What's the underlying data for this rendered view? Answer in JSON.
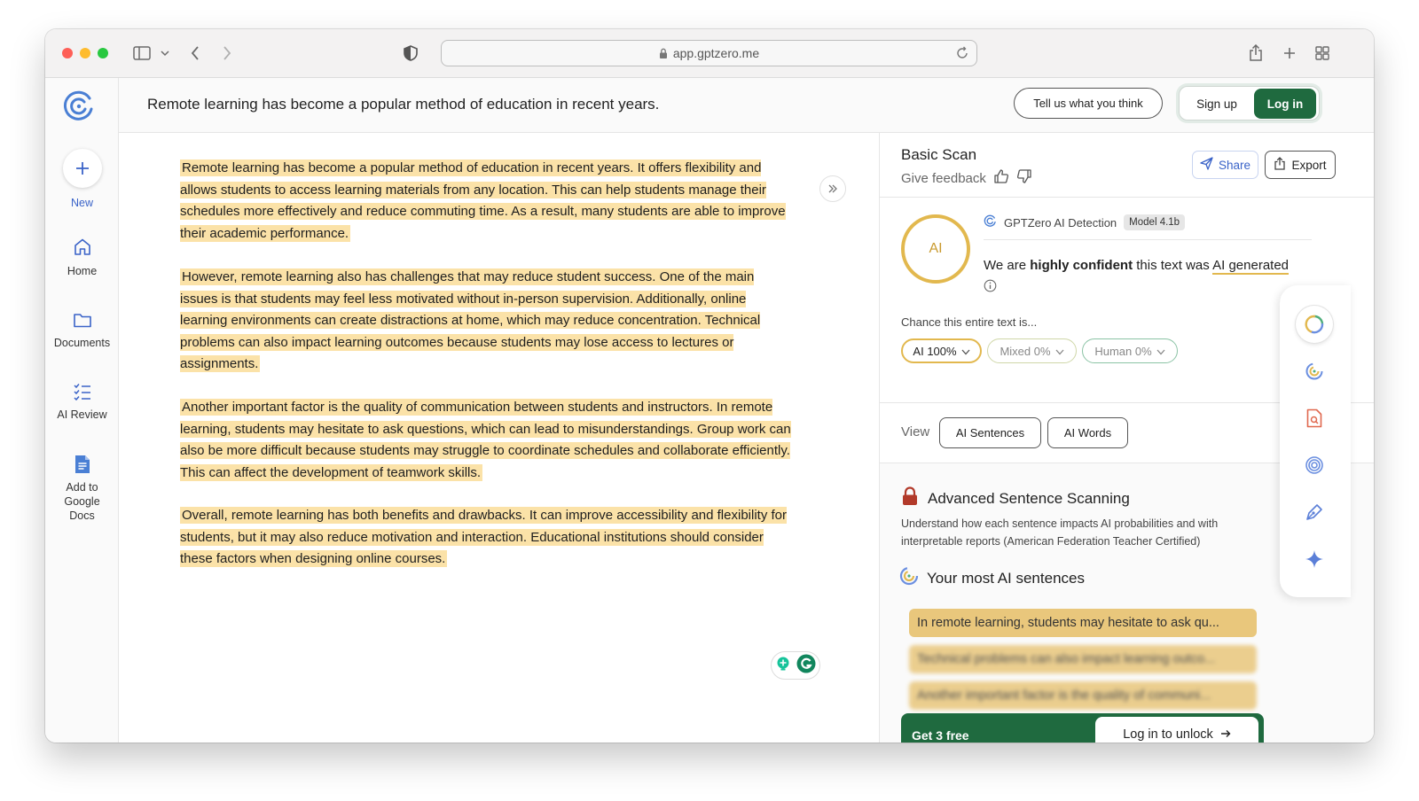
{
  "browser": {
    "url": "app.gptzero.me"
  },
  "nav": {
    "new_label": "New",
    "home_label": "Home",
    "documents_label": "Documents",
    "ai_review_label": "AI Review",
    "google_docs_label": "Add to Google Docs"
  },
  "header": {
    "doc_title": "Remote learning has become a popular method of education in recent years.",
    "feedback_button": "Tell us what you think",
    "signup_button": "Sign up",
    "login_button": "Log in"
  },
  "editor": {
    "paragraphs": [
      "Remote learning has become a popular method of education in recent years. It offers flexibility and allows students to access learning materials from any location. This can help students manage their schedules more effectively and reduce commuting time. As a result, many students are able to improve their academic performance.",
      "However, remote learning also has challenges that may reduce student success. One of the main issues is that students may feel less motivated without in-person supervision. Additionally, online learning environments can create distractions at home, which may reduce concentration. Technical problems can also impact learning outcomes because students may lose access to lectures or assignments.",
      "Another important factor is the quality of communication between students and instructors. In remote learning, students may hesitate to ask questions, which can lead to misunderstandings. Group work can also be more difficult because students may struggle to coordinate schedules and collaborate efficiently. This can affect the development of teamwork skills.",
      "Overall, remote learning has both benefits and drawbacks. It can improve accessibility and flexibility for students, but it may also reduce motivation and interaction. Educational institutions should consider these factors when designing online courses."
    ]
  },
  "panel": {
    "title": "Basic Scan",
    "give_feedback": "Give feedback",
    "share_button": "Share",
    "export_button": "Export",
    "circle_label": "AI",
    "detector_name": "GPTZero AI Detection",
    "model_badge": "Model 4.1b",
    "confidence_prefix": "We are",
    "confidence_bold": "highly confident",
    "confidence_mid": "this text was",
    "confidence_result": "AI generated",
    "chance_label": "Chance this entire text is...",
    "pill_ai": "AI 100%",
    "pill_mixed": "Mixed 0%",
    "pill_human": "Human 0%",
    "view_label": "View",
    "view_sentences": "AI Sentences",
    "view_words": "AI Words",
    "advanced_title": "Advanced Sentence Scanning",
    "advanced_desc": "Understand how each sentence impacts AI probabilities and with interpretable reports (American Federation Teacher Certified)",
    "most_ai_title": "Your most AI sentences",
    "sentences": [
      "In remote learning, students may hesitate to ask qu...",
      "Technical problems can also impact learning outco...",
      "Another important factor is the quality of communi..."
    ],
    "unlock_free": "Get 3 free",
    "unlock_button": "Log in to unlock"
  },
  "colors": {
    "accent_green": "#1f6a3f",
    "highlight": "#fbe2a8",
    "ai_gold": "#e2b84e",
    "link_blue": "#3a63c8"
  }
}
